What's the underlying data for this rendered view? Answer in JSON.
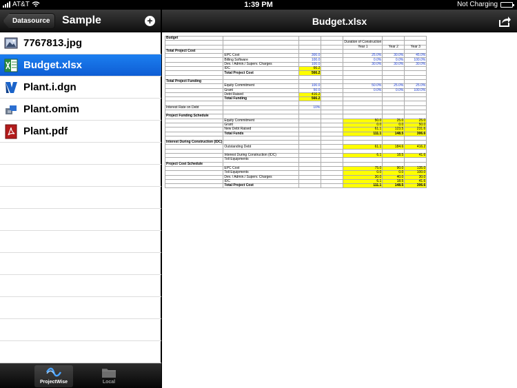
{
  "status": {
    "carrier": "AT&T",
    "time": "1:39 PM",
    "battery_text": "Not Charging"
  },
  "left": {
    "back_label": "Datasource",
    "title": "Sample",
    "files": [
      {
        "name": "7767813.jpg",
        "icon": "image-file-icon",
        "selected": false
      },
      {
        "name": "Budget.xlsx",
        "icon": "excel-file-icon",
        "selected": true
      },
      {
        "name": "Plant.i.dgn",
        "icon": "dgn-file-icon",
        "selected": false
      },
      {
        "name": "Plant.omim",
        "icon": "omim-file-icon",
        "selected": false
      },
      {
        "name": "Plant.pdf",
        "icon": "pdf-file-icon",
        "selected": false
      }
    ],
    "tabs": [
      {
        "label": "ProjectWise",
        "active": true
      },
      {
        "label": "Local",
        "active": false
      }
    ]
  },
  "right": {
    "title": "Budget.xlsx"
  },
  "sheet": {
    "title": "Budget",
    "rows": [
      [
        "Budget",
        "",
        "",
        "",
        "",
        "",
        ""
      ],
      [
        "",
        "",
        "",
        "",
        "Duration of Construction",
        "",
        ""
      ],
      [
        "",
        "",
        "",
        "",
        "Year 1",
        "Year 2",
        "Year 3"
      ],
      [
        "Total Project Cost",
        "",
        "",
        "",
        "",
        "",
        ""
      ],
      [
        "",
        "EPC Cost",
        "300.0",
        "",
        "25.0%",
        "30.0%",
        "45.0%"
      ],
      [
        "",
        "Billing Software",
        "100.0",
        "",
        "0.0%",
        "0.0%",
        "100.0%"
      ],
      [
        "",
        "Dev. / Admin./ Superv. Charges",
        "100.0",
        "",
        "30.0%",
        "30.0%",
        "30.0%"
      ],
      [
        "",
        "IDC",
        "66.2",
        "",
        "",
        "",
        ""
      ],
      [
        "",
        "Total Project Cost",
        "566.2",
        "",
        "",
        "",
        ""
      ],
      [
        "",
        "",
        "",
        "",
        "",
        "",
        ""
      ],
      [
        "Total Project Funding",
        "",
        "",
        "",
        "",
        "",
        ""
      ],
      [
        "",
        "Equity Commitment",
        "100.0",
        "",
        "50.0%",
        "25.0%",
        "25.0%"
      ],
      [
        "",
        "Grant",
        "50.0",
        "",
        "0.0%",
        "0.0%",
        "100.0%"
      ],
      [
        "",
        "Debt Raised",
        "416.2",
        "",
        "",
        "",
        ""
      ],
      [
        "",
        "Total Funding",
        "566.2",
        "",
        "",
        "",
        ""
      ],
      [
        "",
        "",
        "",
        "",
        "",
        "",
        ""
      ],
      [
        "Interest Rate on Debt",
        "",
        "10%",
        "",
        "",
        "",
        ""
      ],
      [
        "",
        "",
        "",
        "",
        "",
        "",
        ""
      ],
      [
        "Project Funding Schedule",
        "",
        "",
        "",
        "",
        "",
        ""
      ],
      [
        "",
        "Equity Commitment",
        "",
        "",
        "50.0",
        "25.0",
        "25.0"
      ],
      [
        "",
        "Grant",
        "",
        "",
        "0.0",
        "0.0",
        "50.0"
      ],
      [
        "",
        "New Debt Raised",
        "",
        "",
        "61.1",
        "123.5",
        "231.6"
      ],
      [
        "",
        "Total Funds",
        "",
        "",
        "111.1",
        "148.5",
        "306.6"
      ],
      [
        "",
        "",
        "",
        "",
        "",
        "",
        ""
      ],
      [
        "Interest During Construction (IDC)",
        "",
        "",
        "",
        "",
        "",
        ""
      ],
      [
        "",
        "Outstanding Debt",
        "",
        "",
        "61.1",
        "184.6",
        "416.2"
      ],
      [
        "",
        "",
        "",
        "",
        "",
        "",
        ""
      ],
      [
        "",
        "Interest During Construction (IDC)",
        "",
        "",
        "6.1",
        "18.5",
        "41.6"
      ],
      [
        "",
        "Toll Equipments",
        "",
        "",
        "",
        "",
        ""
      ],
      [
        "Project Cost Schedule",
        "",
        "",
        "",
        "",
        "",
        ""
      ],
      [
        "",
        "EPC Cost",
        "",
        "",
        "75.0",
        "90.0",
        "135.0"
      ],
      [
        "",
        "Toll Equipments",
        "",
        "",
        "0.0",
        "0.0",
        "100.0"
      ],
      [
        "",
        "Dev. / Admin./ Superv. Charges",
        "",
        "",
        "30.0",
        "40.0",
        "30.0"
      ],
      [
        "",
        "IDC",
        "",
        "",
        "6.1",
        "18.5",
        "41.6"
      ],
      [
        "",
        "Total Project Cost",
        "",
        "",
        "111.1",
        "148.5",
        "306.6"
      ]
    ],
    "yellow": [
      [
        7,
        2
      ],
      [
        8,
        2
      ],
      [
        13,
        2
      ],
      [
        14,
        2
      ],
      [
        19,
        4
      ],
      [
        19,
        5
      ],
      [
        19,
        6
      ],
      [
        20,
        4
      ],
      [
        20,
        5
      ],
      [
        20,
        6
      ],
      [
        21,
        4
      ],
      [
        21,
        5
      ],
      [
        21,
        6
      ],
      [
        22,
        4
      ],
      [
        22,
        5
      ],
      [
        22,
        6
      ],
      [
        25,
        4
      ],
      [
        25,
        5
      ],
      [
        25,
        6
      ],
      [
        27,
        4
      ],
      [
        27,
        5
      ],
      [
        27,
        6
      ],
      [
        30,
        4
      ],
      [
        30,
        5
      ],
      [
        30,
        6
      ],
      [
        31,
        4
      ],
      [
        31,
        5
      ],
      [
        31,
        6
      ],
      [
        32,
        4
      ],
      [
        32,
        5
      ],
      [
        32,
        6
      ],
      [
        33,
        4
      ],
      [
        33,
        5
      ],
      [
        33,
        6
      ],
      [
        34,
        4
      ],
      [
        34,
        5
      ],
      [
        34,
        6
      ]
    ],
    "blue_cols": [
      2,
      4,
      5,
      6
    ],
    "bold_rows": [
      0,
      3,
      8,
      10,
      14,
      18,
      22,
      24,
      29,
      34
    ],
    "highlight_color": "#ffff00",
    "input_text_color": "#1c3ed6"
  }
}
